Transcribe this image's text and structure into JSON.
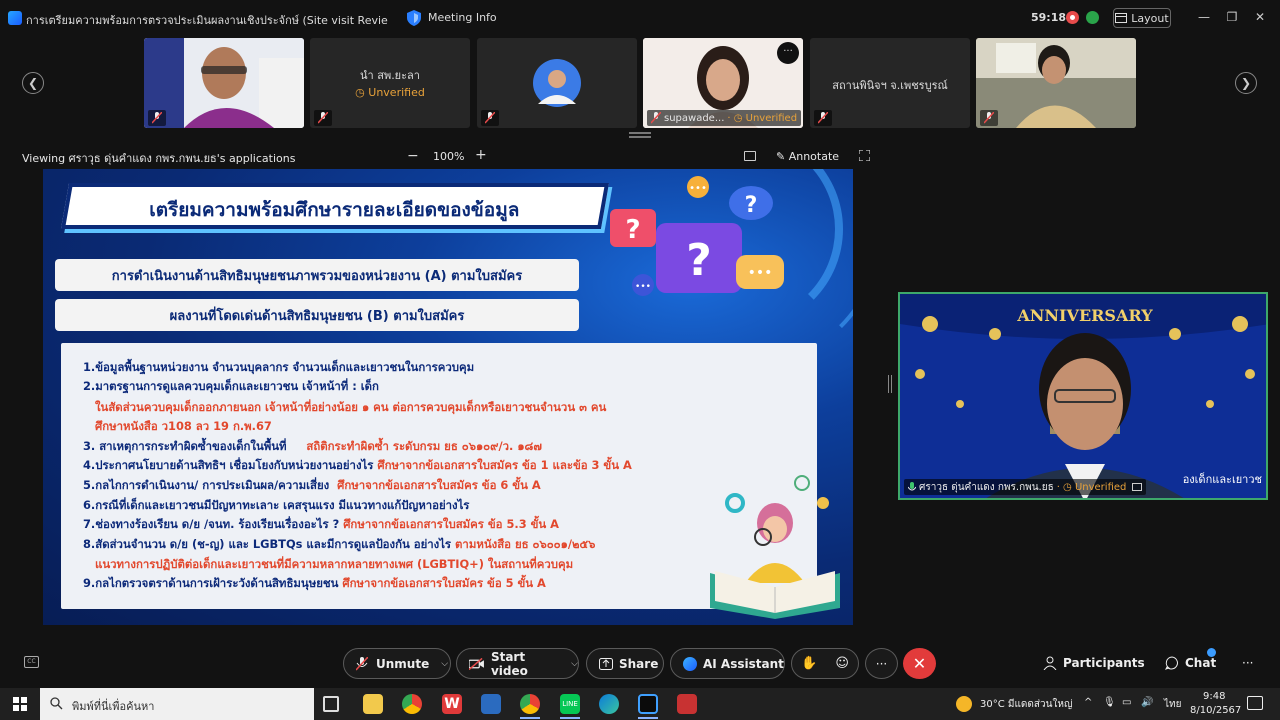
{
  "titlebar": {
    "title": "การเตรียมความพร้อมการตรวจประเมินผลงานเชิงประจักษ์ (Site visit Review) รางวัลองค์...",
    "meeting_info": "Meeting Info",
    "timer": "59:18",
    "layout_label": "Layout"
  },
  "participants_strip": [
    {
      "name": "",
      "unverified": ""
    },
    {
      "name": "นำ สพ.ยะลา",
      "unverified": "Unverified"
    },
    {
      "name": "",
      "unverified": ""
    },
    {
      "name": "supawade...",
      "unverified": "Unverified"
    },
    {
      "name": "สถานพินิจฯ จ.เพชรบูรณ์",
      "unverified": ""
    },
    {
      "name": "",
      "unverified": ""
    }
  ],
  "viewing_bar": {
    "viewing_text": "Viewing ศราวุธ ดุ่นคำแดง กพร.กพน.ยธ's applications",
    "zoom_minus": "−",
    "zoom_level": "100%",
    "zoom_plus": "+",
    "annotate": "Annotate"
  },
  "slide": {
    "title": "เตรียมความพร้อมศึกษารายละเอียดของข้อมูล",
    "pill_a": "การดำเนินงานด้านสิทธิมนุษยชนภาพรวมของหน่วยงาน (A) ตามใบสมัคร",
    "pill_b": "ผลงานที่โดดเด่นด้านสิทธิมนุษยชน (B) ตามใบสมัคร",
    "lines": [
      {
        "main": "1.ข้อมูลพื้นฐานหน่วยงาน จำนวนบุคลากร จำนวนเด็กและเยาวชนในการควบคุม",
        "red": ""
      },
      {
        "main": "2.มาตรฐานการดูแลควบคุมเด็กและเยาวชน เจ้าหน้าที่ : เด็ก",
        "red": ""
      },
      {
        "main": "",
        "red": "ในสัดส่วนควบคุมเด็กออกภายนอก เจ้าหน้าที่อย่างน้อย ๑ คน ต่อการควบคุมเด็กหรือเยาวชนจำนวน ๓ คน"
      },
      {
        "main": "",
        "red": "ศึกษาหนังสือ ว108 ลว 19 ก.พ.67"
      },
      {
        "main": "3. สาเหตุการกระทำผิดซ้ำของเด็กในพื้นที่",
        "red": "สถิติกระทำผิดซ้ำ ระดับกรม ยธ ๐๖๑๐๙/ว. ๑๘๗"
      },
      {
        "main": "4.ประกาศนโยบายด้านสิทธิฯ เชื่อมโยงกับหน่วยงานอย่างไร",
        "red": "ศึกษาจากข้อเอกสารใบสมัคร ข้อ 1 และข้อ 3 ขั้น A"
      },
      {
        "main": "5.กลไกการดำเนินงาน/ การประเมินผล/ความเสี่ยง",
        "red": "ศึกษาจากข้อเอกสารใบสมัคร ข้อ 6 ขั้น A"
      },
      {
        "main": "6.กรณีที่เด็กและเยาวชนมีปัญหาทะเลาะ เคสรุนแรง มีแนวทางแก้ปัญหาอย่างไร",
        "red": ""
      },
      {
        "main": "7.ช่องทางร้องเรียน ด/ย /จนท. ร้องเรียนเรื่องอะไร ?",
        "red": "ศึกษาจากข้อเอกสารใบสมัคร ข้อ 5.3 ขั้น A"
      },
      {
        "main": "8.สัดส่วนจำนวน ด/ย (ช-ญ) และ LGBTQs และมีการดูแลป้องกัน อย่างไร",
        "red": "ตามหนังสือ ยธ ๐๖๐๐๑/๒๕๖"
      },
      {
        "main": "",
        "red": "แนวทางการปฏิบัติต่อเด็กและเยาวชนที่มีความหลากหลายทางเพศ (LGBTIQ+) ในสถานที่ควบคุม"
      },
      {
        "main": "9.กลไกตรวจตราด้านการเฝ้าระวังด้านสิทธิมนุษยชน",
        "red": "ศึกษาจากข้อเอกสารใบสมัคร ข้อ 5 ขั้น A"
      }
    ]
  },
  "self_video": {
    "name": "ศราวุธ ดุ่นคำแดง กพร.กพน.ยธ",
    "unverified": "Unverified",
    "backdrop_text": "ANNIVERSARY",
    "overlay_text": "องเด็กและเยาวช"
  },
  "toolbar": {
    "unmute": "Unmute",
    "start_video": "Start video",
    "share": "Share",
    "ai_assistant": "AI Assistant",
    "more": "···",
    "participants": "Participants",
    "chat": "Chat",
    "overflow": "···"
  },
  "taskbar": {
    "search_placeholder": "พิมพ์ที่นี่เพื่อค้นหา",
    "weather": "30°C มีแดดส่วนใหญ่",
    "lang": "ไทย",
    "time": "9:48",
    "date": "8/10/2567"
  },
  "colors": {
    "accent_blue": "#1b5cff",
    "unverified_orange": "#e8a23a",
    "end_red": "#e23b3b",
    "self_border_green": "#3ea86b"
  }
}
